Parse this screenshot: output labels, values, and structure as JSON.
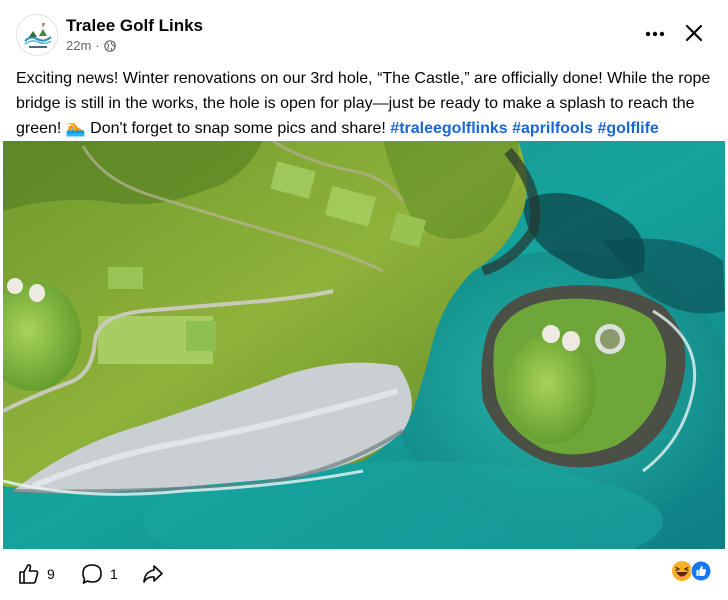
{
  "post": {
    "page_name": "Tralee Golf Links",
    "timestamp": "22m",
    "separator": "·",
    "privacy_icon": "globe-icon",
    "text_main": "Exciting news! Winter renovations on our 3rd hole, “The Castle,” are officially done! While the rope bridge is still in the works, the hole is open for play—just be ready to make a splash to reach the green! ",
    "emoji": "🏊",
    "text_tail": " Don't forget to snap some pics and share! ",
    "hashtags": [
      "#traleegolflinks",
      "#aprilfools",
      "#golflife"
    ],
    "image_description_icon": "aerial-golf-photo"
  },
  "header": {
    "more_icon": "more-horizontal-icon",
    "close_icon": "close-icon"
  },
  "footer": {
    "like_count": "9",
    "comment_count": "1",
    "like_icon": "thumbs-up-icon",
    "comment_icon": "comment-icon",
    "share_icon": "share-icon",
    "reaction_icons": [
      "haha-icon",
      "like-reaction-icon"
    ]
  },
  "colors": {
    "hashtag": "#1b66d6",
    "secondary_text": "#65676b",
    "like_blue": "#1877f2",
    "haha_yellow": "#f7b125"
  }
}
